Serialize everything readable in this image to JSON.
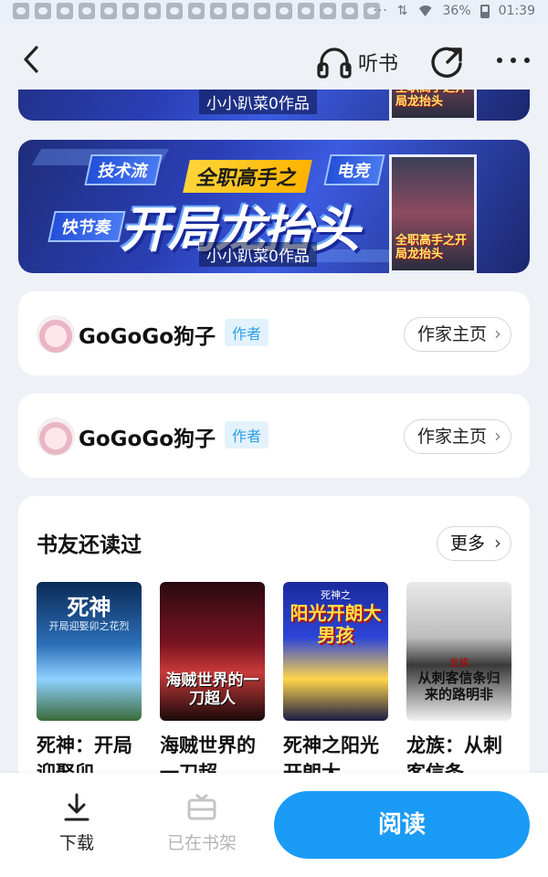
{
  "status_bar": {
    "battery": "36%",
    "time": "01:39",
    "notification_icon_count": 17
  },
  "header": {
    "listen_label": "听书",
    "icons": [
      "back-arrow-icon",
      "headphones-icon",
      "share-icon",
      "more-dots-icon"
    ]
  },
  "banner": {
    "tag1": "技术流",
    "tag2": "快节奏",
    "tag3": "电竞",
    "subtitle": "全职高手之",
    "title": "开局龙抬头",
    "byline": "小小趴菜0作品",
    "cover_text": "全职高手之开局龙抬头",
    "colors": {
      "primary": "#2a3fb5",
      "accent": "#ffd43a"
    }
  },
  "authors": [
    {
      "name": "GoGoGo狗子",
      "badge": "作者",
      "button": "作家主页"
    },
    {
      "name": "GoGoGo狗子",
      "badge": "作者",
      "button": "作家主页"
    }
  ],
  "also_read": {
    "title": "书友还读过",
    "more_label": "更多",
    "books": [
      {
        "title": "死神：开局迎娶卯",
        "cover_text": "死神",
        "cover_sub": "开局迎娶卯之花烈"
      },
      {
        "title": "海贼世界的一刀超",
        "cover_text": "海贼世界的一刀超人",
        "cover_sub": ""
      },
      {
        "title": "死神之阳光开朗大",
        "cover_text": "阳光开朗大男孩",
        "cover_sub": "死神之"
      },
      {
        "title": "龙族：从刺客信条",
        "cover_text": "从刺客信条归来的路明非",
        "cover_sub": "龙族"
      }
    ]
  },
  "bottom_bar": {
    "download_label": "下载",
    "shelf_label": "已在书架",
    "read_label": "阅读",
    "accent_color": "#1a9bf6"
  }
}
